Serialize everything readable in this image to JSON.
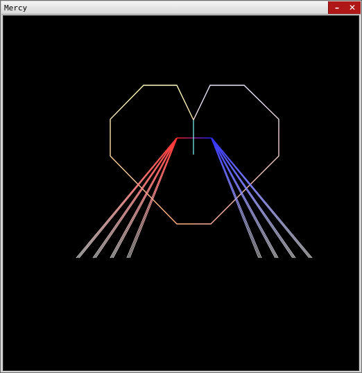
{
  "window": {
    "title": "Mercy",
    "minimize_label": "–",
    "close_label": "✕"
  },
  "colors": {
    "background": "#000000",
    "titlebar_controls": "#b01818",
    "heart_left_top": "#ffffc0",
    "heart_left_bottom": "#ffb080",
    "heart_right_top": "#e8e8ff",
    "heart_right_bottom": "#ffb098",
    "left_beam_start": "#ff3030",
    "left_beam_end": "#ffffff",
    "right_beam_start": "#3030ff",
    "right_beam_end": "#ffffff",
    "bar_left": "#ff2020",
    "bar_right": "#2020ff",
    "stem": "#80ffff"
  },
  "icons": {
    "minimize": "minimize-icon",
    "close": "close-icon"
  }
}
